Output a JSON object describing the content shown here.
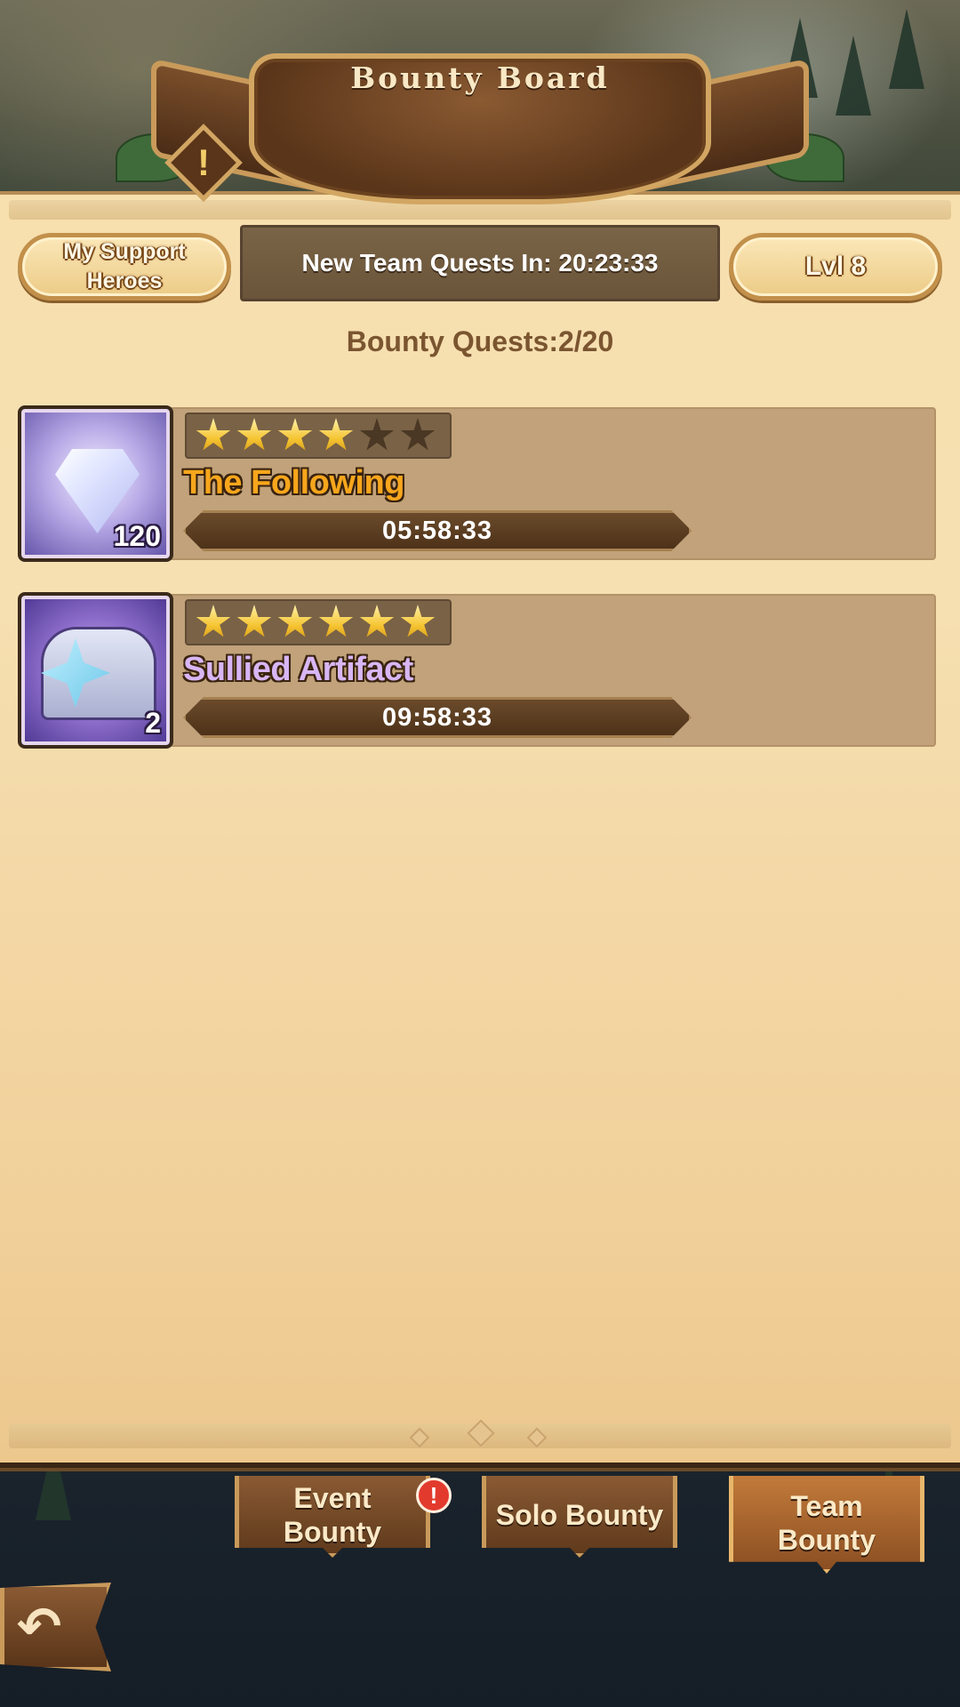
{
  "header": {
    "title": "Bounty Board",
    "info_icon": "exclamation-icon",
    "info_mark": "!"
  },
  "controls": {
    "support_label_line1": "My Support",
    "support_label_line2": "Heroes",
    "timer_text": "New Team Quests In: 20:23:33",
    "level_label": "Lvl 8"
  },
  "summary": {
    "count_label": "Bounty Quests:2/20"
  },
  "quests": [
    {
      "name": "The Following",
      "name_color": "#f7a61c",
      "icon": "diamond-icon",
      "quantity": "120",
      "stars_filled": 4,
      "stars_total": 6,
      "timer": "05:58:33"
    },
    {
      "name": "Sullied Artifact",
      "name_color": "#d8b6f5",
      "icon": "chest-icon",
      "quantity": "2",
      "stars_filled": 6,
      "stars_total": 6,
      "timer": "09:58:33"
    }
  ],
  "tabs": {
    "event_line1": "Event",
    "event_line2": "Bounty",
    "event_alert": "!",
    "solo": "Solo Bounty",
    "team_line1": "Team",
    "team_line2": "Bounty",
    "active": "team"
  },
  "nav": {
    "back_icon": "back-arrow-icon",
    "back_glyph": "↶"
  }
}
